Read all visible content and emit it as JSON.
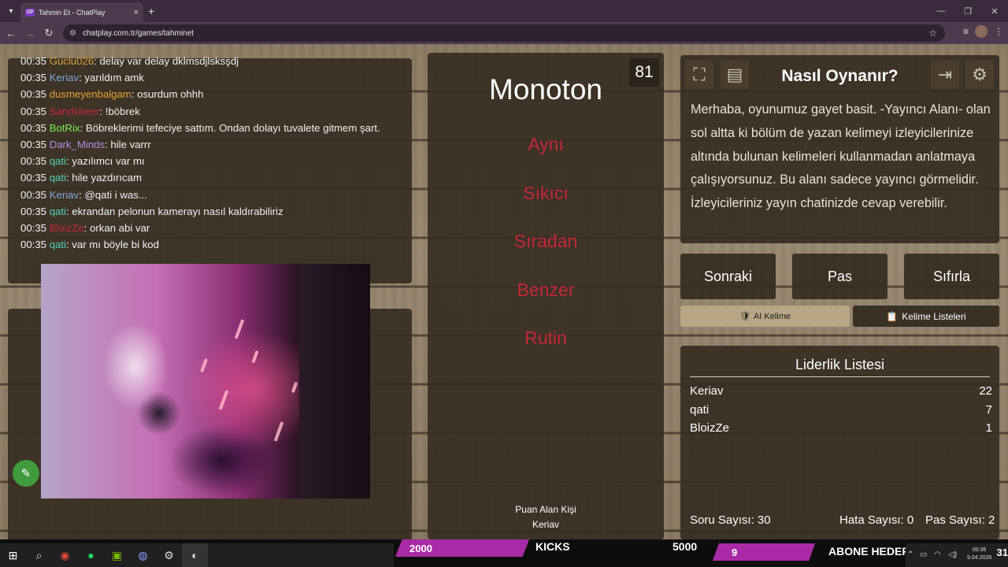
{
  "browser": {
    "tab_favicon": "CP",
    "tab_title": "Tahmin Et - ChatPlay",
    "url": "chatplay.com.tr/games/tahminet"
  },
  "chat": {
    "messages": [
      {
        "time": "00:35",
        "user": "Guclu026",
        "color": "#d9a23e",
        "text": ": delay var delay dklmsdjlsksşdj"
      },
      {
        "time": "00:35",
        "user": "Keriav",
        "color": "#7fa7df",
        "text": ": yarıldım amk"
      },
      {
        "time": "00:35",
        "user": "dusmeyenbalgam",
        "color": "#e3a238",
        "text": ": osurdum ohhh"
      },
      {
        "time": "00:35",
        "user": "Sandsheer",
        "color": "#c22a3a",
        "text": ": !böbrek"
      },
      {
        "time": "00:35",
        "user": "BotRix",
        "color": "#7cf05a",
        "text": ": Böbreklerimi tefeciye sattım. Ondan dolayı tuvalete gitmem şart."
      },
      {
        "time": "00:35",
        "user": "Dark_Minds",
        "color": "#b58de8",
        "text": ": hile varrr"
      },
      {
        "time": "00:35",
        "user": "qati",
        "color": "#52d3b6",
        "text": ": yazılımcı var mı"
      },
      {
        "time": "00:35",
        "user": "qati",
        "color": "#52d3b6",
        "text": ": hile yazdırıcam"
      },
      {
        "time": "00:35",
        "user": "Keriav",
        "color": "#7fa7df",
        "text": ": @qati i was..."
      },
      {
        "time": "00:35",
        "user": "qati",
        "color": "#52d3b6",
        "text": ": ekrandan pelonun kamerayı nasıl kaldırabiliriz"
      },
      {
        "time": "00:35",
        "user": "BloizZe",
        "color": "#c22a3a",
        "text": ": orkan abi var"
      },
      {
        "time": "00:35",
        "user": "qati",
        "color": "#52d3b6",
        "text": ": var mı böyle bi kod"
      }
    ]
  },
  "game": {
    "word": "Monoton",
    "timer": "81",
    "forbidden": [
      "Aynı",
      "Sıkıcı",
      "Sıradan",
      "Benzer",
      "Rutin"
    ],
    "scorer_label": "Puan Alan Kişi",
    "scorer_name": "Keriav"
  },
  "howto": {
    "title": "Nasıl Oynanır?",
    "text": "Merhaba, oyunumuz gayet basit. -Yayıncı Alanı- olan sol altta ki bölüm de yazan kelimeyi izleyicilerinize altında bulunan kelimeleri kullanmadan anlatmaya çalışıyorsunuz. Bu alanı sadece yayıncı görmelidir. İzleyicileriniz yayın chatinizde cevap verebilir."
  },
  "controls": {
    "next": "Sonraki",
    "pass": "Pas",
    "reset": "Sıfırla",
    "ai_word": "AI Kelime",
    "word_lists": "Kelime Listeleri"
  },
  "leaderboard": {
    "title": "Liderlik Listesi",
    "rows": [
      {
        "name": "Keriav",
        "score": "22"
      },
      {
        "name": "qati",
        "score": "7"
      },
      {
        "name": "BloizZe",
        "score": "1"
      }
    ],
    "questions": "Soru Sayısı: 30",
    "errors": "Hata Sayısı: 0",
    "passes": "Pas Sayısı: 2"
  },
  "overlay": {
    "kicks_value": "2000",
    "kicks_label": "KICKS",
    "kicks_goal": "5000",
    "sub_value": "9",
    "sub_label": "ABONE HEDEFİ"
  },
  "taskbar": {
    "time": "00:36",
    "date": "9.04.2026",
    "corner": "31"
  }
}
